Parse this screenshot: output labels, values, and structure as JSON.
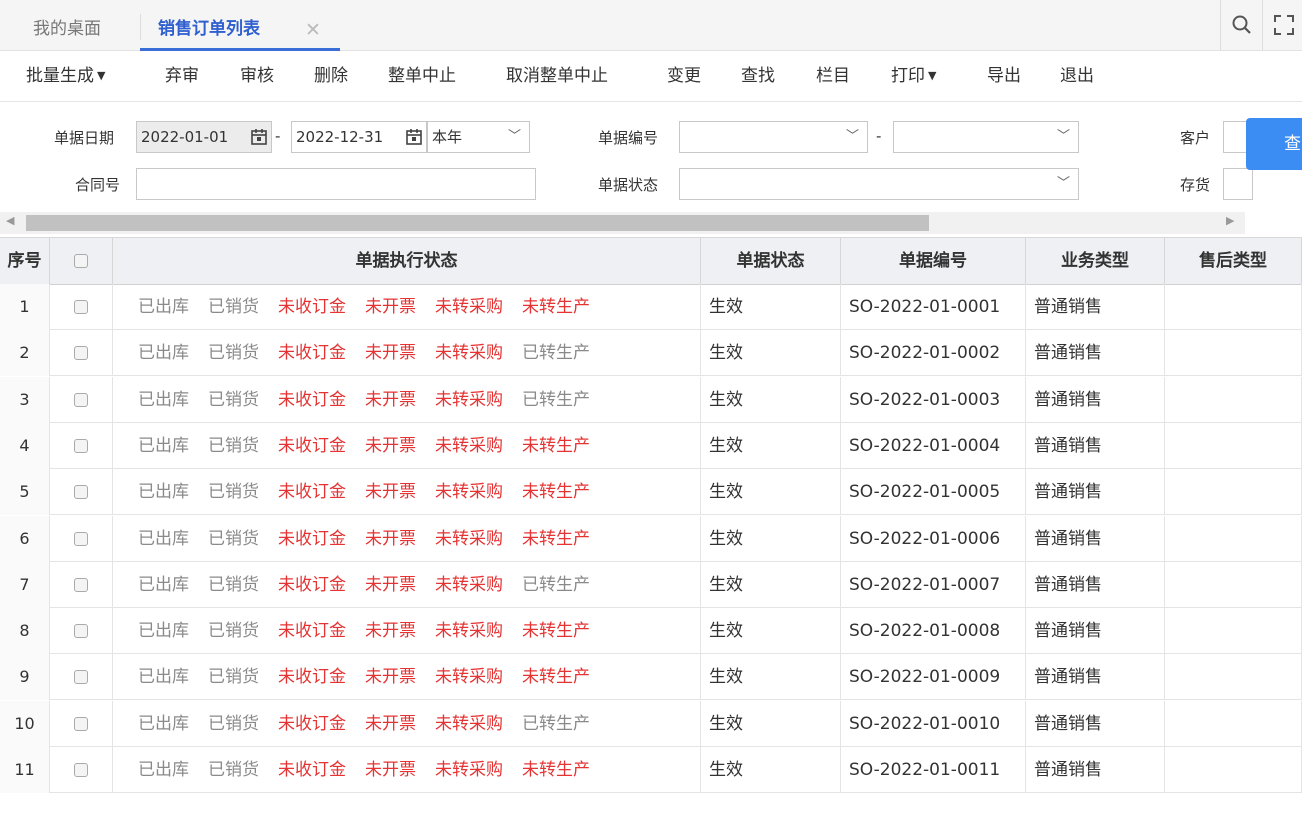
{
  "tabs": {
    "desktop": "我的桌面",
    "active": "销售订单列表",
    "close": "✕"
  },
  "toolbar": [
    {
      "label": "批量生成",
      "caret": true
    },
    {
      "label": "弃审"
    },
    {
      "label": "审核"
    },
    {
      "label": "删除"
    },
    {
      "label": "整单中止"
    },
    {
      "label": "取消整单中止"
    },
    {
      "label": "变更"
    },
    {
      "label": "查找"
    },
    {
      "label": "栏目"
    },
    {
      "label": "打印",
      "caret": true
    },
    {
      "label": "导出"
    },
    {
      "label": "退出"
    }
  ],
  "filters": {
    "date_label": "单据日期",
    "date_from": "2022-01-01",
    "date_sep": "-",
    "date_to": "2022-12-31",
    "period": "本年",
    "docno_label": "单据编号",
    "docno_from": "",
    "docno_sep": "-",
    "docno_to": "",
    "customer_label": "客户",
    "contract_label": "合同号",
    "contract_value": "",
    "docstatus_label": "单据状态",
    "docstatus_value": "",
    "inventory_label": "存货",
    "query_label": "查"
  },
  "table": {
    "columns": [
      "序号",
      "",
      "单据执行状态",
      "单据状态",
      "单据编号",
      "业务类型",
      "售后类型"
    ],
    "rows": [
      {
        "seq": "1",
        "exec": [
          "已出库",
          "已销货",
          "未收订金",
          "未开票",
          "未转采购",
          "未转生产"
        ],
        "status": "生效",
        "no": "SO-2022-01-0001",
        "biz": "普通销售",
        "after": ""
      },
      {
        "seq": "2",
        "exec": [
          "已出库",
          "已销货",
          "未收订金",
          "未开票",
          "未转采购",
          "已转生产"
        ],
        "status": "生效",
        "no": "SO-2022-01-0002",
        "biz": "普通销售",
        "after": ""
      },
      {
        "seq": "3",
        "exec": [
          "已出库",
          "已销货",
          "未收订金",
          "未开票",
          "未转采购",
          "已转生产"
        ],
        "status": "生效",
        "no": "SO-2022-01-0003",
        "biz": "普通销售",
        "after": ""
      },
      {
        "seq": "4",
        "exec": [
          "已出库",
          "已销货",
          "未收订金",
          "未开票",
          "未转采购",
          "未转生产"
        ],
        "status": "生效",
        "no": "SO-2022-01-0004",
        "biz": "普通销售",
        "after": ""
      },
      {
        "seq": "5",
        "exec": [
          "已出库",
          "已销货",
          "未收订金",
          "未开票",
          "未转采购",
          "未转生产"
        ],
        "status": "生效",
        "no": "SO-2022-01-0005",
        "biz": "普通销售",
        "after": ""
      },
      {
        "seq": "6",
        "exec": [
          "已出库",
          "已销货",
          "未收订金",
          "未开票",
          "未转采购",
          "未转生产"
        ],
        "status": "生效",
        "no": "SO-2022-01-0006",
        "biz": "普通销售",
        "after": ""
      },
      {
        "seq": "7",
        "exec": [
          "已出库",
          "已销货",
          "未收订金",
          "未开票",
          "未转采购",
          "已转生产"
        ],
        "status": "生效",
        "no": "SO-2022-01-0007",
        "biz": "普通销售",
        "after": ""
      },
      {
        "seq": "8",
        "exec": [
          "已出库",
          "已销货",
          "未收订金",
          "未开票",
          "未转采购",
          "未转生产"
        ],
        "status": "生效",
        "no": "SO-2022-01-0008",
        "biz": "普通销售",
        "after": ""
      },
      {
        "seq": "9",
        "exec": [
          "已出库",
          "已销货",
          "未收订金",
          "未开票",
          "未转采购",
          "未转生产"
        ],
        "status": "生效",
        "no": "SO-2022-01-0009",
        "biz": "普通销售",
        "after": ""
      },
      {
        "seq": "10",
        "exec": [
          "已出库",
          "已销货",
          "未收订金",
          "未开票",
          "未转采购",
          "已转生产"
        ],
        "status": "生效",
        "no": "SO-2022-01-0010",
        "biz": "普通销售",
        "after": ""
      },
      {
        "seq": "11",
        "exec": [
          "已出库",
          "已销货",
          "未收订金",
          "未开票",
          "未转采购",
          "未转生产"
        ],
        "status": "生效",
        "no": "SO-2022-01-0011",
        "biz": "普通销售",
        "after": ""
      }
    ]
  },
  "colors": {
    "accent": "#3b6fd8",
    "todo": "#e53333",
    "done": "#8a8a8a",
    "query_button": "#3b8cf3"
  },
  "icons": {
    "search": "search-icon",
    "fullscreen": "fullscreen-icon",
    "calendar": "calendar-icon"
  }
}
